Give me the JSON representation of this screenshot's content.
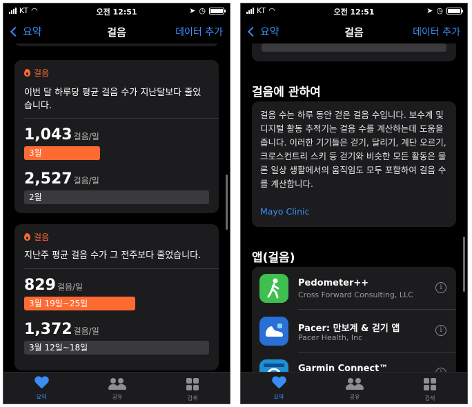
{
  "status": {
    "carrier": "KT",
    "time": "오전 12:51"
  },
  "left": {
    "nav": {
      "back": "요약",
      "title": "걸음",
      "action": "데이터 추가"
    },
    "cards": [
      {
        "head": "걸음",
        "message": "이번 달 하루당 평균 걸음 수가 지난달보다 줄었습니다.",
        "current": {
          "value": "1,043",
          "unit": "걸음/일",
          "label": "3월",
          "fraction": 0.41
        },
        "previous": {
          "value": "2,527",
          "unit": "걸음/일",
          "label": "2월",
          "fraction": 1.0
        }
      },
      {
        "head": "걸음",
        "message": "지난주 평균 걸음 수가 그 전주보다 줄었습니다.",
        "current": {
          "value": "829",
          "unit": "걸음/일",
          "label": "3월 19일~25일",
          "fraction": 0.6
        },
        "previous": {
          "value": "1,372",
          "unit": "걸음/일",
          "label": "3월 12일~18일",
          "fraction": 1.0
        }
      }
    ]
  },
  "right": {
    "nav": {
      "back": "요약",
      "title": "걸음",
      "action": "데이터 추가"
    },
    "about": {
      "title": "걸음에 관하여",
      "text": "걸음 수는 하루 동안 걷은 걸음 수입니다. 보수계 및 디지털 활동 추적기는 걸음 수를 계산하는데 도움을 줍니다. 이러한 기기들은 걷기, 달리기, 계단 오르기, 크로스컨트리 스키 등 걷기와 비슷한 모든 활동은 물론 일상 생활에서의 움직임도 모두 포함하여 걸음 수를 계산합니다.",
      "link": "Mayo Clinic"
    },
    "apps_title": "앱(걸음)",
    "apps": [
      {
        "name": "Pedometer++",
        "developer": "Cross Forward Consulting, LLC",
        "color": "#3fbf4f"
      },
      {
        "name": "Pacer: 만보계 & 걷기 앱",
        "developer": "Pacer Health, Inc",
        "color": "#2a6fd6"
      },
      {
        "name": "Garmin Connect™",
        "developer": "",
        "color": "#1f8fd6"
      }
    ]
  },
  "tabs": [
    {
      "label": "요약",
      "icon": "heart-icon",
      "active": true
    },
    {
      "label": "공유",
      "icon": "people-icon",
      "active": false
    },
    {
      "label": "검색",
      "icon": "grid-icon",
      "active": false
    }
  ],
  "colors": {
    "accent": "#3a8df5",
    "steps": "#ff6a33",
    "card": "#1c1c1e"
  }
}
